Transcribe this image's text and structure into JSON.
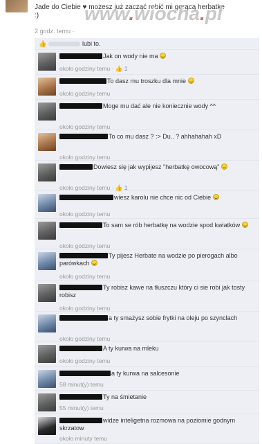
{
  "watermark": {
    "text": "www.wiocha.pl"
  },
  "post": {
    "text_line1": "Jade do Ciebie ♥ możesz już zacząć robić mi gorącą herbatkę",
    "text_line2": ":)",
    "time": "2 godz. temu",
    "sep": "·",
    "like_label": "Lubię to!"
  },
  "like_bar": {
    "suffix": "lubi to."
  },
  "comments": [
    {
      "text": "Jak on wody nie ma",
      "smile": true,
      "time": "około godziny temu",
      "likes": "1",
      "avatar": "m"
    },
    {
      "text": "To dasz mu troszku dla mnie",
      "smile": true,
      "time": "około godziny temu",
      "likes": "",
      "avatar": "f"
    },
    {
      "text": "Moge mu dać ale nie koniecznie wody ^^",
      "smile": false,
      "time": "około godziny temu",
      "likes": "",
      "avatar": "m"
    },
    {
      "text": "To co mu dasz ? :> Du.. ? ahhahahah xD",
      "smile": false,
      "time": "około godziny temu",
      "likes": "",
      "avatar": "f"
    },
    {
      "text": "Dowiesz się jak wypijesz \"herbatkę owocową\"",
      "smile": true,
      "time": "około godziny temu",
      "likes": "1",
      "avatar": "m"
    },
    {
      "text": "wiesz karolu nie chce nic od Ciebie",
      "smile": true,
      "time": "około godziny temu",
      "likes": "",
      "avatar": "b"
    },
    {
      "text": "To sam se rób herbatkę na wodzie spod kwiatków",
      "smile": true,
      "time": "około godziny temu",
      "likes": "",
      "avatar": "m"
    },
    {
      "text": "Ty pijesz Herbate na wodzie po pierogach albo parówkach",
      "smile": true,
      "time": "około godziny temu",
      "likes": "",
      "avatar": "b"
    },
    {
      "text": "Ty robisz kawe na tłuszczu który ci sie robi jak tosty robisz",
      "smile": false,
      "time": "około godziny temu",
      "likes": "",
      "avatar": "m"
    },
    {
      "text": "a ty smażysz sobie frytki na oleju po szynclach",
      "smile": false,
      "time": "około godziny temu",
      "likes": "",
      "avatar": "b"
    },
    {
      "text": "A ty kurwa na mleku",
      "smile": false,
      "time": "około godziny temu",
      "likes": "",
      "avatar": "m"
    },
    {
      "text": "a ty kurwa na salcesonie",
      "smile": false,
      "time": "58 minut(y) temu",
      "likes": "",
      "avatar": "b"
    },
    {
      "text": "Ty na śmietanie",
      "smile": false,
      "time": "55 minut(y) temu",
      "likes": "",
      "avatar": "m"
    },
    {
      "text": "widze inteligetna rozmowa na poziomie godnym skrzatow",
      "smile": false,
      "time": "około minuty temu",
      "likes": "",
      "avatar": "d"
    }
  ]
}
